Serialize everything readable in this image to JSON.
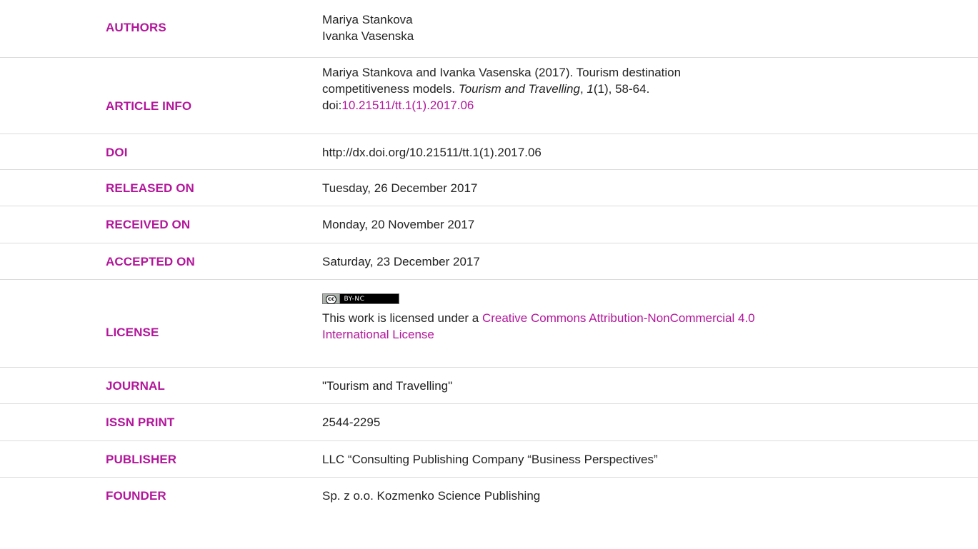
{
  "rows": [
    {
      "label": "AUTHORS",
      "lines": [
        "Mariya Stankova",
        "Ivanka Vasenska"
      ]
    },
    {
      "label": "ARTICLE INFO",
      "citation": {
        "prefix": "Mariya Stankova and Ivanka Vasenska (2017). Tourism destination",
        "line2_pre": "competitiveness models. ",
        "journal_italic": "Tourism and Travelling",
        "comma": ", ",
        "volume_italic": "1",
        "issue_pages": "(1), 58-64.",
        "doi_prefix": "doi:",
        "doi_link": "10.21511/tt.1(1).2017.06"
      }
    },
    {
      "label": "DOI",
      "value": "http://dx.doi.org/10.21511/tt.1(1).2017.06"
    },
    {
      "label": "RELEASED ON",
      "value": "Tuesday, 26 December 2017"
    },
    {
      "label": "RECEIVED ON",
      "value": "Monday, 20 November 2017"
    },
    {
      "label": "ACCEPTED ON",
      "value": "Saturday, 23 December 2017"
    },
    {
      "label": "LICENSE",
      "license": {
        "badge_logo": "cc",
        "badge_terms": "BY-NC",
        "text_prefix": "This work is licensed under a ",
        "link_line1": "Creative Commons Attribution-NonCommercial 4.0",
        "link_line2": "International License"
      }
    },
    {
      "label": "JOURNAL",
      "value": "\"Tourism and Travelling\""
    },
    {
      "label": "ISSN PRINT",
      "value": "2544-2295"
    },
    {
      "label": "PUBLISHER",
      "value": "LLC “Consulting Publishing Company “Business Perspectives”"
    },
    {
      "label": "FOUNDER",
      "value": "Sp. z o.o. Kozmenko Science Publishing"
    }
  ],
  "colors": {
    "label": "#b3169b",
    "text": "#222222",
    "link": "#b3169b",
    "divider": "#dcdcdc"
  }
}
